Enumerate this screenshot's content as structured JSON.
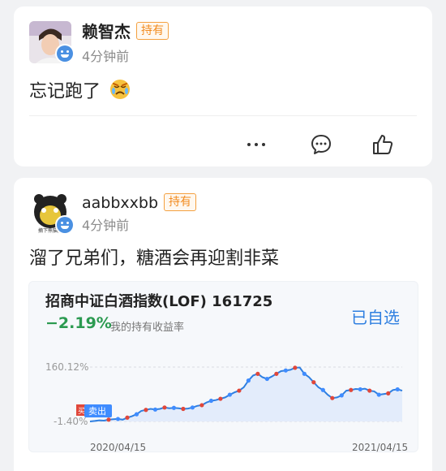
{
  "posts": [
    {
      "username": "赖智杰",
      "badge": "持有",
      "time": "4分钟前",
      "text": "忘记跑了",
      "text_emoji": "angry-crying-face-emoji",
      "actions": [
        "more-icon",
        "comment-icon",
        "like-icon"
      ]
    },
    {
      "username": "aabbxxbb",
      "badge": "持有",
      "time": "4分钟前",
      "text": "溜了兄弟们，糖酒会再迎割非菜",
      "avatar_caption": "摘下熊猫头"
    }
  ],
  "fund": {
    "name": "招商中证白酒指数(LOF) 161725",
    "return_pct": "−2.19%",
    "return_label": "我的持有收益率",
    "watch_label": "已自选",
    "sell_marker": "卖出",
    "buy_marker": "买"
  },
  "chart_data": {
    "type": "line",
    "y_top_label": "160.12%",
    "y_bottom_label": "-1.40%",
    "x_start_label": "2020/04/15",
    "x_end_label": "2021/04/15",
    "ylim": [
      -1.4,
      160.12
    ],
    "series": [
      {
        "values": [
          -1.4,
          0,
          2,
          1,
          4,
          5,
          6,
          4,
          10,
          14,
          20,
          30,
          33,
          36,
          34,
          36,
          40,
          38,
          39,
          38,
          36,
          37,
          40,
          45,
          47,
          55,
          60,
          62,
          66,
          70,
          78,
          85,
          90,
          100,
          120,
          135,
          140,
          130,
          125,
          132,
          140,
          148,
          150,
          152,
          158,
          159,
          140,
          130,
          115,
          100,
          92,
          78,
          68,
          70,
          76,
          90,
          92,
          95,
          94,
          96,
          90,
          88,
          78,
          80,
          82,
          92,
          94,
          90
        ]
      }
    ],
    "colors": {
      "line": "#2f7fe0",
      "fill": "#e3ecfb",
      "buy_dot": "#e0473a",
      "sell_dot": "#3f8cff"
    }
  }
}
